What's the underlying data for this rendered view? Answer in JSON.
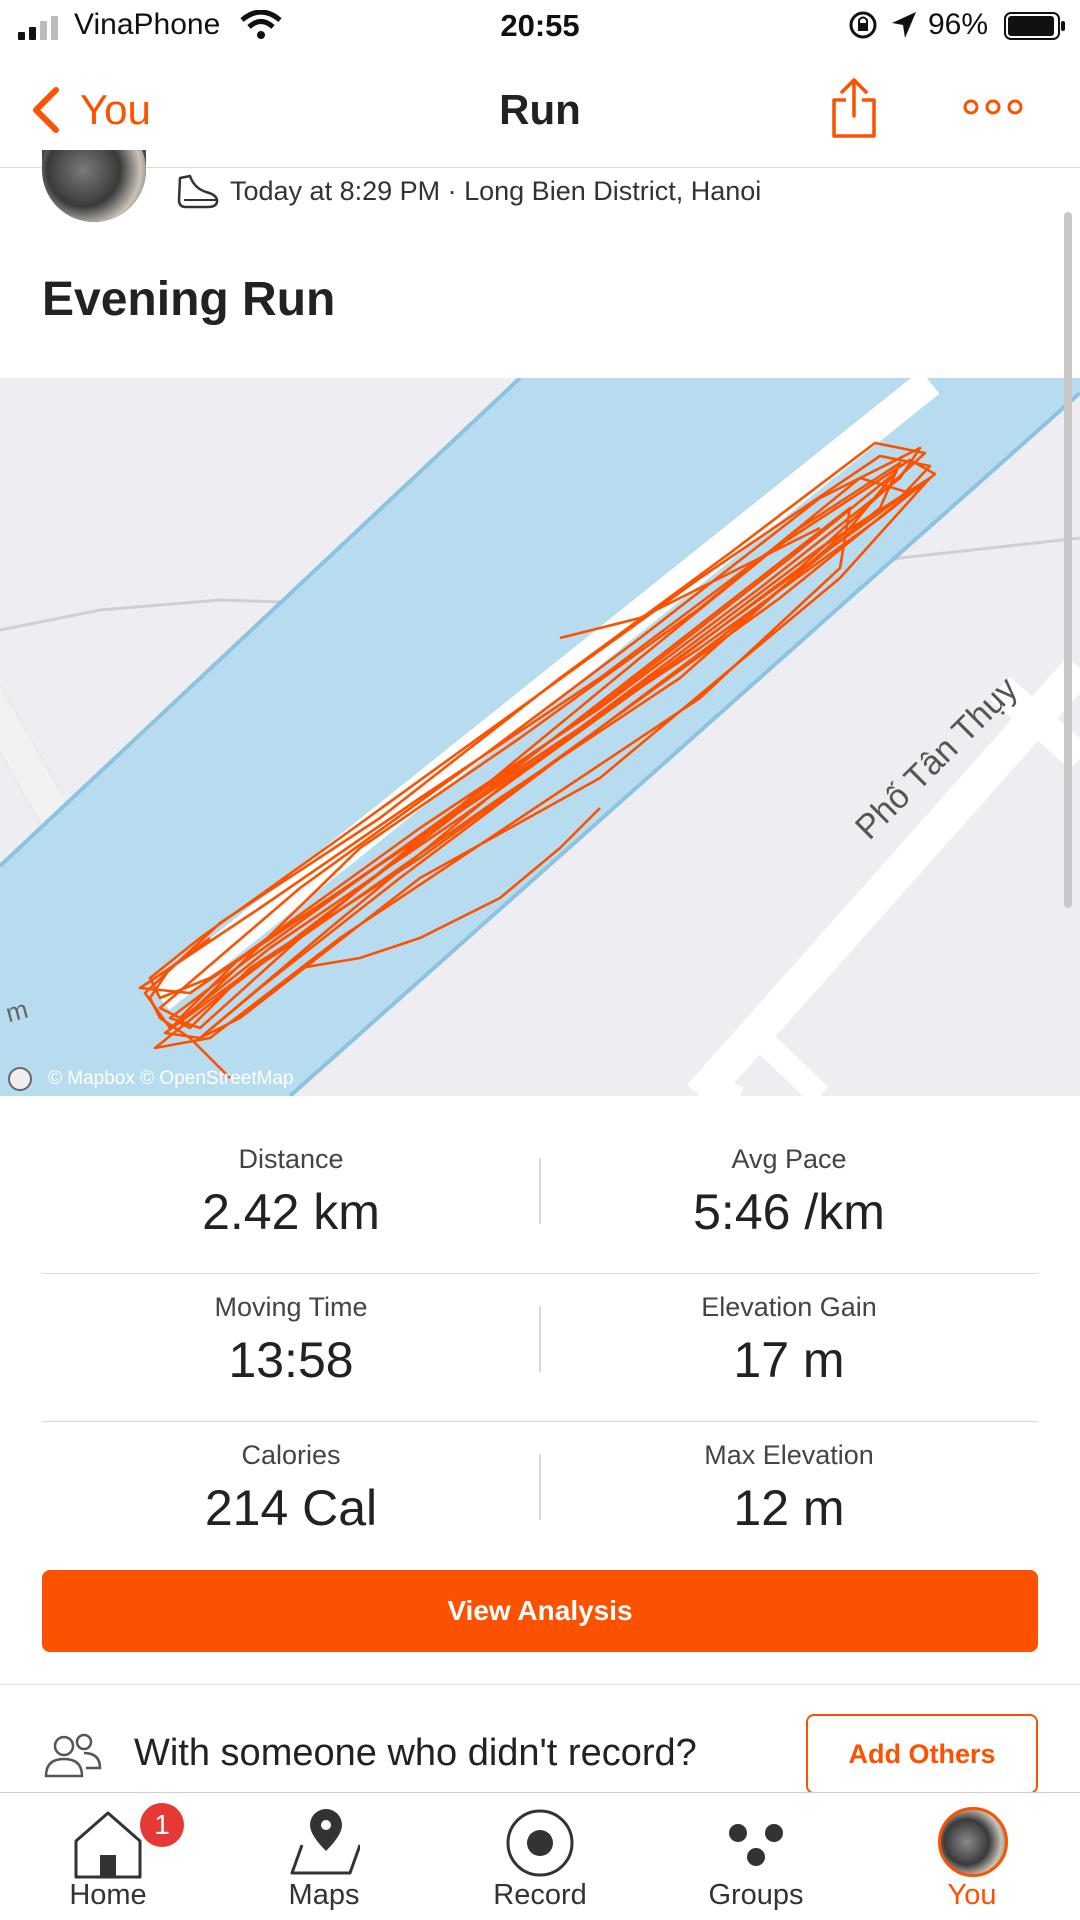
{
  "status_bar": {
    "carrier": "VinaPhone",
    "time": "20:55",
    "battery_percent": "96%",
    "icons": [
      "signal-icon",
      "wifi-icon",
      "rotation-lock-icon",
      "location-arrow-icon",
      "battery-icon"
    ]
  },
  "nav": {
    "back_label": "You",
    "title": "Run",
    "icons": [
      "chevron-left-icon",
      "share-icon",
      "more-icon"
    ]
  },
  "activity": {
    "meta": "Today at 8:29 PM · Long Bien District, Hanoi",
    "title": "Evening Run",
    "icon": "shoe-icon"
  },
  "map": {
    "street_label": "Phố Tân Thụy",
    "edge_label": "m",
    "attribution": "© Mapbox © OpenStreetMap",
    "route_color": "#fc5200",
    "water_color": "#b8dcef"
  },
  "stats": [
    {
      "left": {
        "label": "Distance",
        "value": "2.42 km"
      },
      "right": {
        "label": "Avg Pace",
        "value": "5:46 /km"
      }
    },
    {
      "left": {
        "label": "Moving Time",
        "value": "13:58"
      },
      "right": {
        "label": "Elevation Gain",
        "value": "17 m"
      }
    },
    {
      "left": {
        "label": "Calories",
        "value": "214 Cal"
      },
      "right": {
        "label": "Max Elevation",
        "value": "12 m"
      }
    }
  ],
  "actions": {
    "view_analysis": "View Analysis",
    "with_someone": "With someone who didn't record?",
    "add_others": "Add Others"
  },
  "tab_bar": {
    "tabs": [
      {
        "label": "Home",
        "icon": "home-icon",
        "badge": "1"
      },
      {
        "label": "Maps",
        "icon": "map-pin-icon"
      },
      {
        "label": "Record",
        "icon": "record-icon"
      },
      {
        "label": "Groups",
        "icon": "groups-icon"
      },
      {
        "label": "You",
        "icon": "avatar",
        "active": true
      }
    ]
  },
  "colors": {
    "accent": "#fc5200",
    "badge": "#e53935"
  }
}
